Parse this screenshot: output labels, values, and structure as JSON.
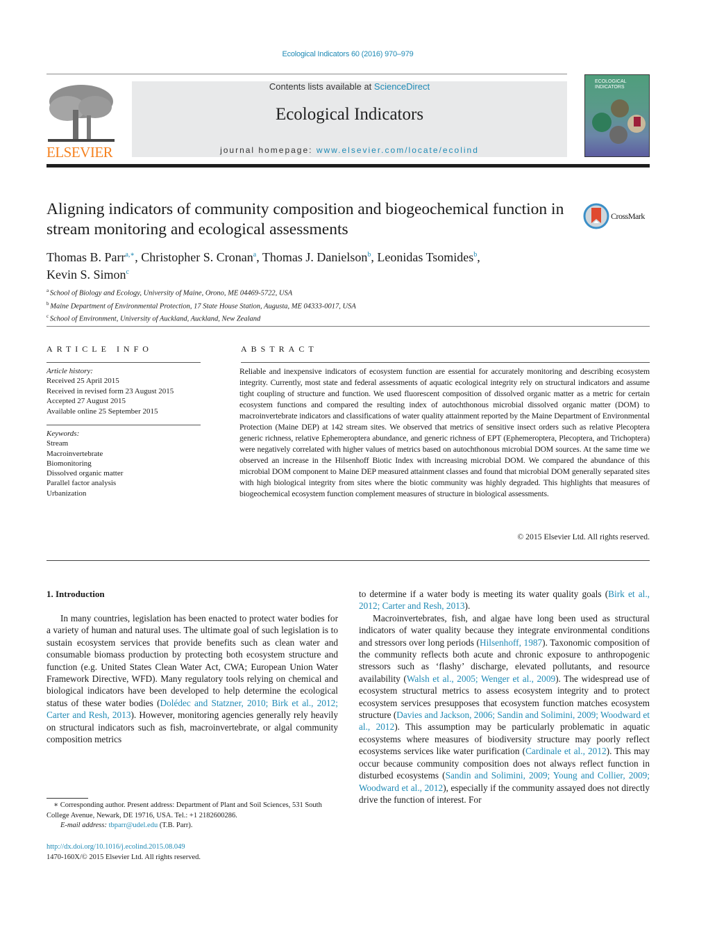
{
  "header": {
    "journal_ref": "Ecological Indicators 60 (2016) 970–979",
    "contents_prefix": "Contents lists available at ",
    "contents_link": "ScienceDirect",
    "journal_title": "Ecological Indicators",
    "homepage_prefix": "journal homepage: ",
    "homepage_link": "www.elsevier.com/locate/ecolind",
    "publisher_logo": "ELSEVIER",
    "cover_title_line1": "ECOLOGICAL",
    "cover_title_line2": "INDICATORS"
  },
  "article": {
    "title": "Aligning indicators of community composition and biogeochemical function in stream monitoring and ecological assessments",
    "crossmark_label": "CrossMark",
    "authors": [
      {
        "name": "Thomas B. Parr",
        "sup": "a,∗",
        "sep": ", "
      },
      {
        "name": "Christopher S. Cronan",
        "sup": "a",
        "sep": ", "
      },
      {
        "name": "Thomas J. Danielson",
        "sup": "b",
        "sep": ", "
      },
      {
        "name": "Leonidas Tsomides",
        "sup": "b",
        "sep": ","
      },
      {
        "name": "Kevin S. Simon",
        "sup": "c",
        "sep": ""
      }
    ],
    "affiliations": [
      {
        "mark": "a",
        "text": "School of Biology and Ecology, University of Maine, Orono, ME 04469-5722, USA"
      },
      {
        "mark": "b",
        "text": "Maine Department of Environmental Protection, 17 State House Station, Augusta, ME 04333-0017, USA"
      },
      {
        "mark": "c",
        "text": "School of Environment, University of Auckland, Auckland, New Zealand"
      }
    ]
  },
  "article_info": {
    "heading": "ARTICLE INFO",
    "history_label": "Article history:",
    "history": [
      "Received 25 April 2015",
      "Received in revised form 23 August 2015",
      "Accepted 27 August 2015",
      "Available online 25 September 2015"
    ],
    "keywords_label": "Keywords:",
    "keywords": [
      "Stream",
      "Macroinvertebrate",
      "Biomonitoring",
      "Dissolved organic matter",
      "Parallel factor analysis",
      "Urbanization"
    ]
  },
  "abstract": {
    "heading": "ABSTRACT",
    "text": "Reliable and inexpensive indicators of ecosystem function are essential for accurately monitoring and describing ecosystem integrity. Currently, most state and federal assessments of aquatic ecological integrity rely on structural indicators and assume tight coupling of structure and function. We used fluorescent composition of dissolved organic matter as a metric for certain ecosystem functions and compared the resulting index of autochthonous microbial dissolved organic matter (DOM) to macroinvertebrate indicators and classifications of water quality attainment reported by the Maine Department of Environmental Protection (Maine DEP) at 142 stream sites. We observed that metrics of sensitive insect orders such as relative Plecoptera generic richness, relative Ephemeroptera abundance, and generic richness of EPT (Ephemeroptera, Plecoptera, and Trichoptera) were negatively correlated with higher values of metrics based on autochthonous microbial DOM sources. At the same time we observed an increase in the Hilsenhoff Biotic Index with increasing microbial DOM. We compared the abundance of this microbial DOM component to Maine DEP measured attainment classes and found that microbial DOM generally separated sites with high biological integrity from sites where the biotic community was highly degraded. This highlights that measures of biogeochemical ecosystem function complement measures of structure in biological assessments.",
    "copyright": "© 2015 Elsevier Ltd. All rights reserved."
  },
  "body": {
    "section_heading": "1.  Introduction",
    "left_col": [
      {
        "t": "In many countries, legislation has been enacted to protect water bodies for a variety of human and natural uses. The ultimate goal of such legislation is to sustain ecosystem services that provide benefits such as clean water and consumable biomass production by protecting both ecosystem structure and function (e.g. United States Clean Water Act, CWA; European Union Water Framework Directive, WFD). Many regulatory tools relying on chemical and biological indicators have been developed to help determine the ecological status of these water bodies ("
      },
      {
        "t": "Dolédec and Statzner, 2010; Birk et al., 2012; Carter and Resh, 2013",
        "link": true
      },
      {
        "t": "). However, monitoring agencies generally rely heavily on structural indicators such as fish, macroinvertebrate, or algal community composition metrics"
      }
    ],
    "right_col_p1": [
      {
        "t": "to determine if a water body is meeting its water quality goals ("
      },
      {
        "t": "Birk et al., 2012; Carter and Resh, 2013",
        "link": true
      },
      {
        "t": ")."
      }
    ],
    "right_col_p2": [
      {
        "t": "Macroinvertebrates, fish, and algae have long been used as structural indicators of water quality because they integrate environmental conditions and stressors over long periods ("
      },
      {
        "t": "Hilsenhoff, 1987",
        "link": true
      },
      {
        "t": "). Taxonomic composition of the community reflects both acute and chronic exposure to anthropogenic stressors such as ‘flashy’ discharge, elevated pollutants, and resource availability ("
      },
      {
        "t": "Walsh et al., 2005; Wenger et al., 2009",
        "link": true
      },
      {
        "t": "). The widespread use of ecosystem structural metrics to assess ecosystem integrity and to protect ecosystem services presupposes that ecosystem function matches ecosystem structure ("
      },
      {
        "t": "Davies and Jackson, 2006; Sandin and Solimini, 2009; Woodward et al., 2012",
        "link": true
      },
      {
        "t": "). This assumption may be particularly problematic in aquatic ecosystems where measures of biodiversity structure may poorly reflect ecosystems services like water purification ("
      },
      {
        "t": "Cardinale et al., 2012",
        "link": true
      },
      {
        "t": "). This may occur because community composition does not always reflect function in disturbed ecosystems ("
      },
      {
        "t": "Sandin and Solimini, 2009; Young and Collier, 2009; Woodward et al., 2012",
        "link": true
      },
      {
        "t": "), especially if the community assayed does not directly drive the function of interest. For"
      }
    ]
  },
  "footnote": {
    "corresponding": "∗  Corresponding author. Present address: Department of Plant and Soil Sciences, 531 South College Avenue, Newark, DE 19716, USA. Tel.: +1 2182600286.",
    "email_label": "E-mail address: ",
    "email": "tbparr@udel.edu",
    "email_suffix": " (T.B. Parr).",
    "doi": "http://dx.doi.org/10.1016/j.ecolind.2015.08.049",
    "issn": "1470-160X/© 2015 Elsevier Ltd. All rights reserved."
  },
  "colors": {
    "link": "#1f8ab5",
    "elsevier_orange": "#f58220",
    "banner_bg": "#e8e9ea"
  }
}
